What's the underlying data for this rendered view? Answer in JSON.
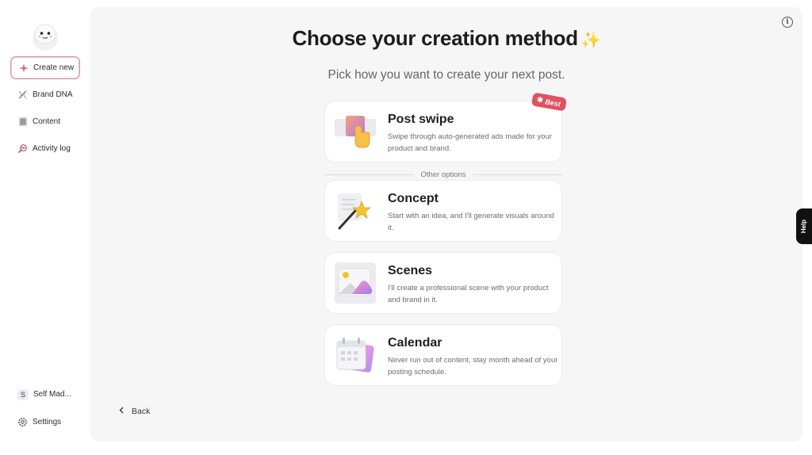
{
  "sidebar": {
    "items": [
      {
        "label": "Create new",
        "icon": "sparkle-plus-icon"
      },
      {
        "label": "Brand DNA",
        "icon": "dna-icon"
      },
      {
        "label": "Content",
        "icon": "stack-icon"
      },
      {
        "label": "Activity log",
        "icon": "activity-search-icon"
      }
    ],
    "workspace": {
      "initial": "S",
      "label": "Self Mad..."
    },
    "settings_label": "Settings"
  },
  "main": {
    "title": "Choose your creation method",
    "subtitle": "Pick how you want to create your next post.",
    "divider_label": "Other options",
    "back_label": "Back",
    "cards": [
      {
        "title": "Post swipe",
        "description": "Swipe through auto-generated ads made for your product and brand.",
        "badge": "Best",
        "icon": "swipe-hand-icon"
      },
      {
        "title": "Concept",
        "description": "Start with an idea, and I'll generate visuals around it.",
        "icon": "magic-wand-icon"
      },
      {
        "title": "Scenes",
        "description": "I'll create a professional scene with your product and brand in it.",
        "icon": "image-scene-icon"
      },
      {
        "title": "Calendar",
        "description": "Never run out of content, stay month ahead of your posting schedule.",
        "icon": "calendar-stack-icon"
      }
    ]
  },
  "help_label": "Help",
  "colors": {
    "accent": "#e05260",
    "panel": "#f6f6f6",
    "active_border": "#e98a8a"
  }
}
